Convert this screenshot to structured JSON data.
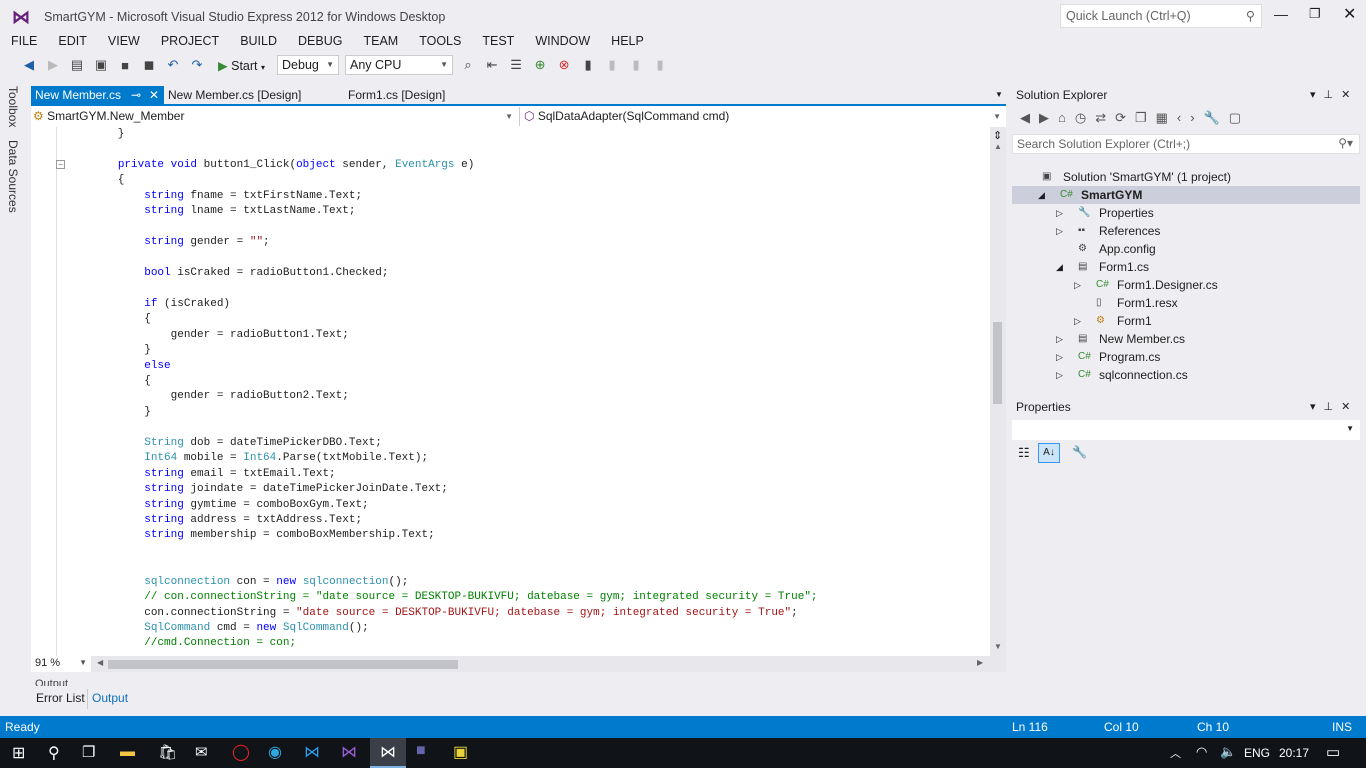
{
  "window": {
    "title": "SmartGYM - Microsoft Visual Studio Express 2012 for Windows Desktop",
    "quick_launch_placeholder": "Quick Launch (Ctrl+Q)"
  },
  "menu": [
    "FILE",
    "EDIT",
    "VIEW",
    "PROJECT",
    "BUILD",
    "DEBUG",
    "TEAM",
    "TOOLS",
    "TEST",
    "WINDOW",
    "HELP"
  ],
  "toolbar": {
    "start_label": "Start",
    "config": "Debug",
    "platform": "Any CPU"
  },
  "left_tabs": [
    "Toolbox",
    "Data Sources"
  ],
  "doc_tabs": [
    {
      "label": "New Member.cs",
      "active": true
    },
    {
      "label": "New Member.cs [Design]"
    },
    {
      "label": "Form1.cs [Design]"
    }
  ],
  "nav": {
    "type": "SmartGYM.New_Member",
    "member": "SqlDataAdapter(SqlCommand cmd)"
  },
  "code": [
    [
      [
        "p",
        "        }"
      ]
    ],
    [],
    [
      [
        "p",
        "        "
      ],
      [
        "kw",
        "private void"
      ],
      [
        "p",
        " button1_Click("
      ],
      [
        "kw",
        "object"
      ],
      [
        "p",
        " sender, "
      ],
      [
        "ty",
        "EventArgs"
      ],
      [
        "p",
        " e)"
      ]
    ],
    [
      [
        "p",
        "        {"
      ]
    ],
    [
      [
        "p",
        "            "
      ],
      [
        "kw",
        "string"
      ],
      [
        "p",
        " fname = txtFirstName.Text;"
      ]
    ],
    [
      [
        "p",
        "            "
      ],
      [
        "kw",
        "string"
      ],
      [
        "p",
        " lname = txtLastName.Text;"
      ]
    ],
    [],
    [
      [
        "p",
        "            "
      ],
      [
        "kw",
        "string"
      ],
      [
        "p",
        " gender = "
      ],
      [
        "st",
        "\"\""
      ],
      [
        "p",
        ";"
      ]
    ],
    [],
    [
      [
        "p",
        "            "
      ],
      [
        "kw",
        "bool"
      ],
      [
        "p",
        " isCraked = radioButton1.Checked;"
      ]
    ],
    [],
    [
      [
        "p",
        "            "
      ],
      [
        "kw",
        "if"
      ],
      [
        "p",
        " (isCraked)"
      ]
    ],
    [
      [
        "p",
        "            {"
      ]
    ],
    [
      [
        "p",
        "                gender = radioButton1.Text;"
      ]
    ],
    [
      [
        "p",
        "            }"
      ]
    ],
    [
      [
        "p",
        "            "
      ],
      [
        "kw",
        "else"
      ]
    ],
    [
      [
        "p",
        "            {"
      ]
    ],
    [
      [
        "p",
        "                gender = radioButton2.Text;"
      ]
    ],
    [
      [
        "p",
        "            }"
      ]
    ],
    [],
    [
      [
        "p",
        "            "
      ],
      [
        "ty",
        "String"
      ],
      [
        "p",
        " dob = dateTimePickerDBO.Text;"
      ]
    ],
    [
      [
        "p",
        "            "
      ],
      [
        "ty",
        "Int64"
      ],
      [
        "p",
        " mobile = "
      ],
      [
        "ty",
        "Int64"
      ],
      [
        "p",
        ".Parse(txtMobile.Text);"
      ]
    ],
    [
      [
        "p",
        "            "
      ],
      [
        "kw",
        "string"
      ],
      [
        "p",
        " email = txtEmail.Text;"
      ]
    ],
    [
      [
        "p",
        "            "
      ],
      [
        "kw",
        "string"
      ],
      [
        "p",
        " joindate = dateTimePickerJoinDate.Text;"
      ]
    ],
    [
      [
        "p",
        "            "
      ],
      [
        "kw",
        "string"
      ],
      [
        "p",
        " gymtime = comboBoxGym.Text;"
      ]
    ],
    [
      [
        "p",
        "            "
      ],
      [
        "kw",
        "string"
      ],
      [
        "p",
        " address = txtAddress.Text;"
      ]
    ],
    [
      [
        "p",
        "            "
      ],
      [
        "kw",
        "string"
      ],
      [
        "p",
        " membership = comboBoxMembership.Text;"
      ]
    ],
    [],
    [],
    [
      [
        "p",
        "            "
      ],
      [
        "ty",
        "sqlconnection"
      ],
      [
        "p",
        " con = "
      ],
      [
        "kw",
        "new"
      ],
      [
        "p",
        " "
      ],
      [
        "ty",
        "sqlconnection"
      ],
      [
        "p",
        "();"
      ]
    ],
    [
      [
        "p",
        "            "
      ],
      [
        "cm",
        "// con.connectionString = \"date source = DESKTOP-BUKIVFU; datebase = gym; integrated security = True\";"
      ]
    ],
    [
      [
        "p",
        "            con.connectionString = "
      ],
      [
        "st",
        "\"date source = DESKTOP-BUKIVFU; datebase = gym; integrated security = True\""
      ],
      [
        "p",
        ";"
      ]
    ],
    [
      [
        "p",
        "            "
      ],
      [
        "ty",
        "SqlCommand"
      ],
      [
        "p",
        " cmd = "
      ],
      [
        "kw",
        "new"
      ],
      [
        "p",
        " "
      ],
      [
        "ty",
        "SqlCommand"
      ],
      [
        "p",
        "();"
      ]
    ],
    [
      [
        "p",
        "            "
      ],
      [
        "cm",
        "//cmd.Connection = con;"
      ]
    ]
  ],
  "zoom": "91 %",
  "output": {
    "title": "Output",
    "tabs": [
      "Error List",
      "Output"
    ]
  },
  "status": {
    "ready": "Ready",
    "ln": "Ln 116",
    "col": "Col 10",
    "ch": "Ch 10",
    "ins": "INS"
  },
  "solution_explorer": {
    "title": "Solution Explorer",
    "search_placeholder": "Search Solution Explorer (Ctrl+;)",
    "items": [
      {
        "label": "Solution 'SmartGYM' (1 project)",
        "indent": 0,
        "icon": "solution-icon"
      },
      {
        "label": "SmartGYM",
        "indent": 1,
        "icon": "csharp-project-icon",
        "expanded": true,
        "selected": true
      },
      {
        "label": "Properties",
        "indent": 2,
        "icon": "wrench-icon",
        "expander": "collapsed"
      },
      {
        "label": "References",
        "indent": 2,
        "icon": "references-icon",
        "expander": "collapsed"
      },
      {
        "label": "App.config",
        "indent": 2,
        "icon": "config-file-icon"
      },
      {
        "label": "Form1.cs",
        "indent": 2,
        "icon": "form-icon",
        "expander": "expanded"
      },
      {
        "label": "Form1.Designer.cs",
        "indent": 3,
        "icon": "cs-file-icon",
        "expander": "collapsed"
      },
      {
        "label": "Form1.resx",
        "indent": 3,
        "icon": "resx-file-icon"
      },
      {
        "label": "Form1",
        "indent": 3,
        "icon": "class-icon",
        "expander": "collapsed"
      },
      {
        "label": "New Member.cs",
        "indent": 2,
        "icon": "form-icon",
        "expander": "collapsed"
      },
      {
        "label": "Program.cs",
        "indent": 2,
        "icon": "cs-file-icon",
        "expander": "collapsed"
      },
      {
        "label": "sqlconnection.cs",
        "indent": 2,
        "icon": "cs-file-icon",
        "expander": "collapsed"
      }
    ]
  },
  "properties": {
    "title": "Properties"
  },
  "taskbar": {
    "lang": "ENG",
    "time": "20:17"
  },
  "colors": {
    "accent": "#007acc",
    "keyword": "#0000ff",
    "type": "#2b91af",
    "string": "#a31515",
    "comment": "#008000"
  }
}
